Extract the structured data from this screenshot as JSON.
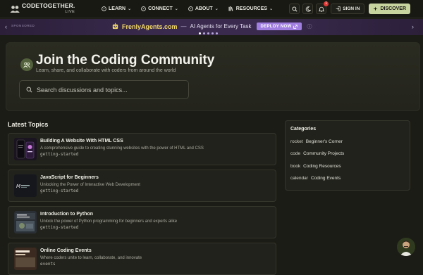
{
  "brand": {
    "name": "CODETOGETHER.",
    "sub": "LIVE"
  },
  "nav": [
    {
      "label": "LEARN",
      "icon": "compass-icon"
    },
    {
      "label": "CONNECT",
      "icon": "compass-icon"
    },
    {
      "label": "ABOUT",
      "icon": "compass-icon"
    },
    {
      "label": "RESOURCES",
      "icon": "books-icon"
    }
  ],
  "header": {
    "notifications_count": "1",
    "signin_label": "SIGN IN",
    "discover_label": "DISCOVER"
  },
  "sponsor": {
    "label": "SPONSORED",
    "brand": "FrenlyAgents.com",
    "dash": "—",
    "tagline": "AI Agents for Every Task",
    "cta": "DEPLOY NOW",
    "dots": 5,
    "active_dot": 0
  },
  "hero": {
    "title": "Join the Coding Community",
    "subtitle": "Learn, share, and collaborate with coders from around the world",
    "search_placeholder": "Search discussions and topics..."
  },
  "latest": {
    "title": "Latest Topics",
    "topics": [
      {
        "title": "Building A Website With HTML CSS",
        "desc": "A comprehensive guide to creating stunning websites with the power of HTML and CSS",
        "tag": "getting-started"
      },
      {
        "title": "JavaScript for Beginners",
        "desc": "Unlocking the Power of Interactive Web Development",
        "tag": "getting-started"
      },
      {
        "title": "Introduction to Python",
        "desc": "Unlock the power of Python programming for beginners and experts alike",
        "tag": "getting-started"
      },
      {
        "title": "Online Coding Events",
        "desc": "Where coders unite to learn, collaborate, and innovate",
        "tag": "events"
      }
    ]
  },
  "categories": {
    "title": "Categories",
    "items": [
      {
        "icon": "rocket",
        "label": "Beginner's Corner"
      },
      {
        "icon": "code",
        "label": "Community Projects"
      },
      {
        "icon": "book",
        "label": "Coding Resources"
      },
      {
        "icon": "calendar",
        "label": "Coding Events"
      }
    ]
  },
  "colors": {
    "accent": "#c8d4a0",
    "sponsor_bg": "#3a2b4e",
    "brand_yellow": "#f2d86a",
    "deploy": "#a07ee0"
  }
}
